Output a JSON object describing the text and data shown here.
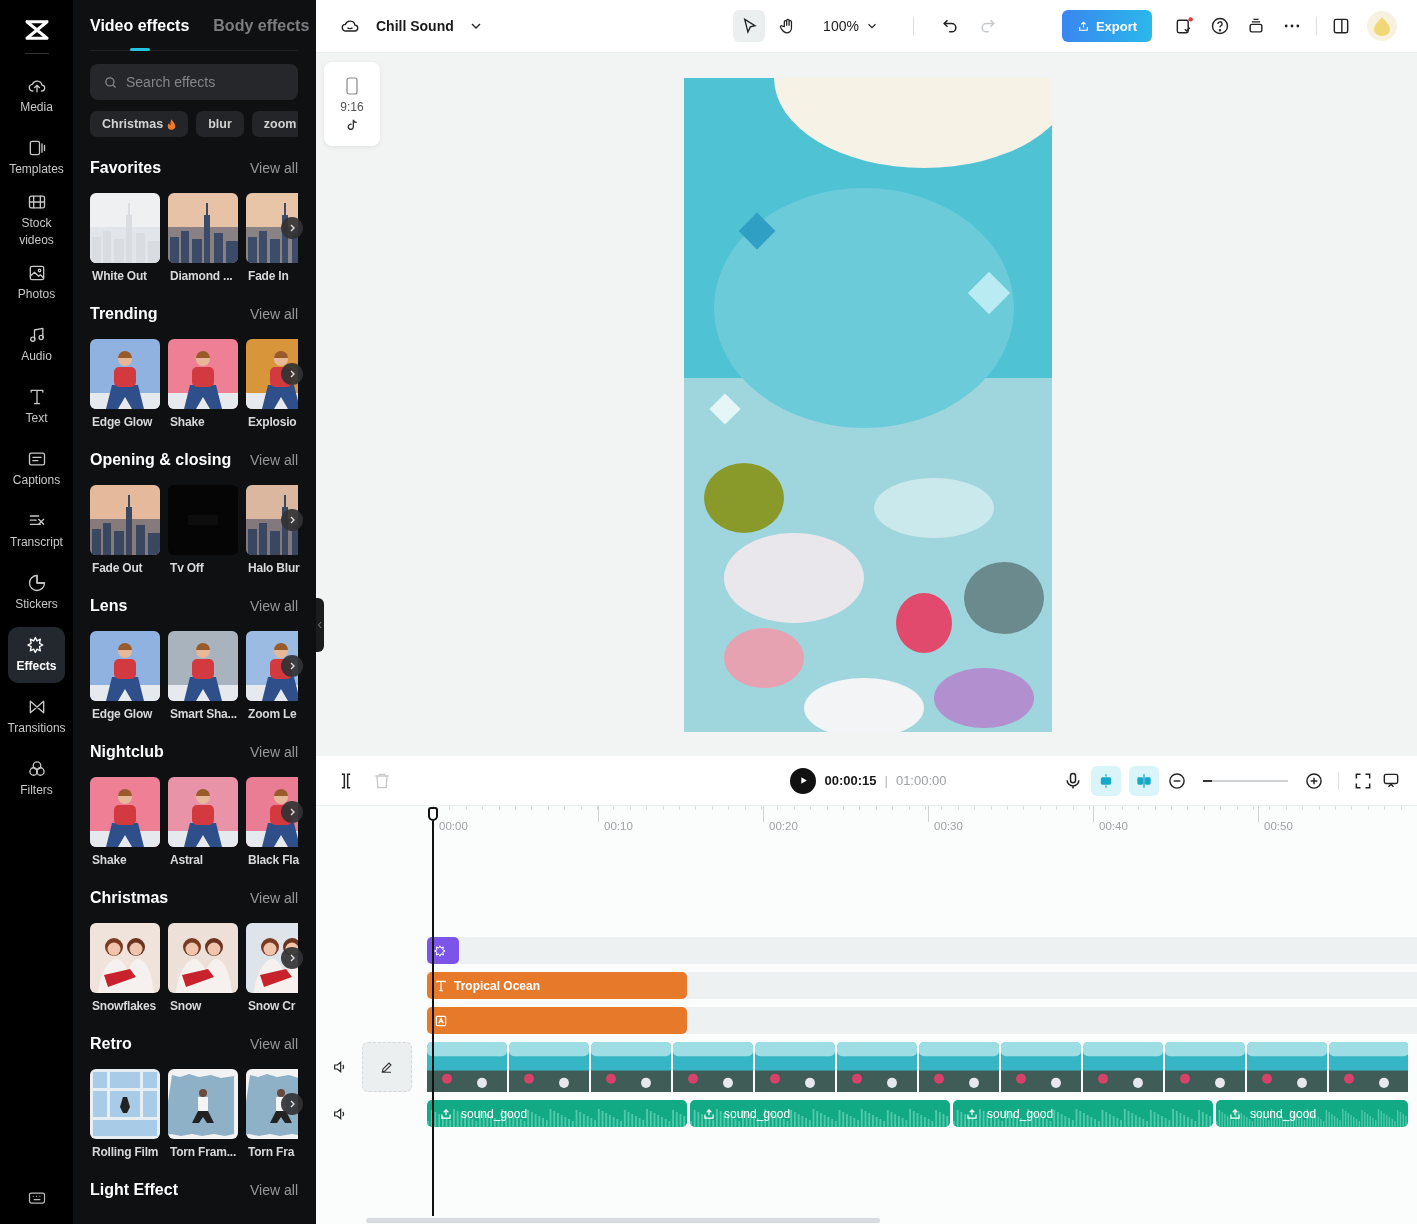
{
  "rail": {
    "items": [
      {
        "label": "Media",
        "kind": "media",
        "selected": false
      },
      {
        "label": "Templates",
        "kind": "templates",
        "selected": false
      },
      {
        "label": "Stock videos",
        "kind": "stock",
        "selected": false
      },
      {
        "label": "Photos",
        "kind": "photos",
        "selected": false
      },
      {
        "label": "Audio",
        "kind": "audio",
        "selected": false
      },
      {
        "label": "Text",
        "kind": "text",
        "selected": false
      },
      {
        "label": "Captions",
        "kind": "captions",
        "selected": false
      },
      {
        "label": "Transcript",
        "kind": "transcript",
        "selected": false
      },
      {
        "label": "Stickers",
        "kind": "stickers",
        "selected": false
      },
      {
        "label": "Effects",
        "kind": "effects",
        "selected": true
      },
      {
        "label": "Transitions",
        "kind": "transitions",
        "selected": false
      },
      {
        "label": "Filters",
        "kind": "filters",
        "selected": false
      }
    ]
  },
  "panel": {
    "tabs": [
      {
        "label": "Video effects",
        "selected": true
      },
      {
        "label": "Body effects",
        "selected": false
      }
    ],
    "search": {
      "placeholder": "Search effects"
    },
    "chips": [
      {
        "label": "Christmas",
        "hot": true
      },
      {
        "label": "blur",
        "hot": false
      },
      {
        "label": "zoom",
        "hot": false
      }
    ],
    "sections": [
      {
        "title": "Favorites",
        "link": "View all",
        "items": [
          {
            "name": "White Out"
          },
          {
            "name": "Diamond ..."
          },
          {
            "name": "Fade In"
          }
        ]
      },
      {
        "title": "Trending",
        "link": "View all",
        "items": [
          {
            "name": "Edge Glow"
          },
          {
            "name": "Shake"
          },
          {
            "name": "Explosio"
          }
        ]
      },
      {
        "title": "Opening & closing",
        "link": "View all",
        "items": [
          {
            "name": "Fade Out"
          },
          {
            "name": "Tv Off"
          },
          {
            "name": "Halo Blur"
          }
        ]
      },
      {
        "title": "Lens",
        "link": "View all",
        "items": [
          {
            "name": "Edge Glow"
          },
          {
            "name": "Smart Sha..."
          },
          {
            "name": "Zoom Le"
          }
        ]
      },
      {
        "title": "Nightclub",
        "link": "View all",
        "items": [
          {
            "name": "Shake"
          },
          {
            "name": "Astral"
          },
          {
            "name": "Black Fla"
          }
        ]
      },
      {
        "title": "Christmas",
        "link": "View all",
        "items": [
          {
            "name": "Snowflakes"
          },
          {
            "name": "Snow"
          },
          {
            "name": "Snow Cr"
          }
        ]
      },
      {
        "title": "Retro",
        "link": "View all",
        "items": [
          {
            "name": "Rolling Film"
          },
          {
            "name": "Torn Fram..."
          },
          {
            "name": "Torn Fra"
          }
        ]
      },
      {
        "title": "Light Effect",
        "link": "View all"
      }
    ]
  },
  "topbar": {
    "project": "Chill Sound",
    "zoom": "100%",
    "tools": [
      {
        "kind": "pointer",
        "selected": true
      },
      {
        "kind": "hand",
        "selected": false
      }
    ],
    "redo": {
      "disabled": true
    },
    "export": "Export"
  },
  "canvas": {
    "ratio": "9:16"
  },
  "timeline": {
    "time": "00:00:15",
    "separator": "|",
    "duration": "01:00:00",
    "delete": {
      "disabled": true
    },
    "toggles": [
      {
        "kind": "snap",
        "on": true
      },
      {
        "kind": "split",
        "on": true
      }
    ],
    "zoom": {
      "level": 0.1
    },
    "ruler": [
      "00:00",
      "00:10",
      "00:20",
      "00:30",
      "00:40",
      "00:50"
    ],
    "tracks": [
      {
        "kind": "effect"
      },
      {
        "kind": "text",
        "label": "Tropical Ocean"
      },
      {
        "kind": "sticker"
      },
      {
        "kind": "video"
      },
      {
        "kind": "audio",
        "clips": [
          "sound_good",
          "sound_good",
          "sound_good",
          "sound_good"
        ]
      }
    ]
  }
}
